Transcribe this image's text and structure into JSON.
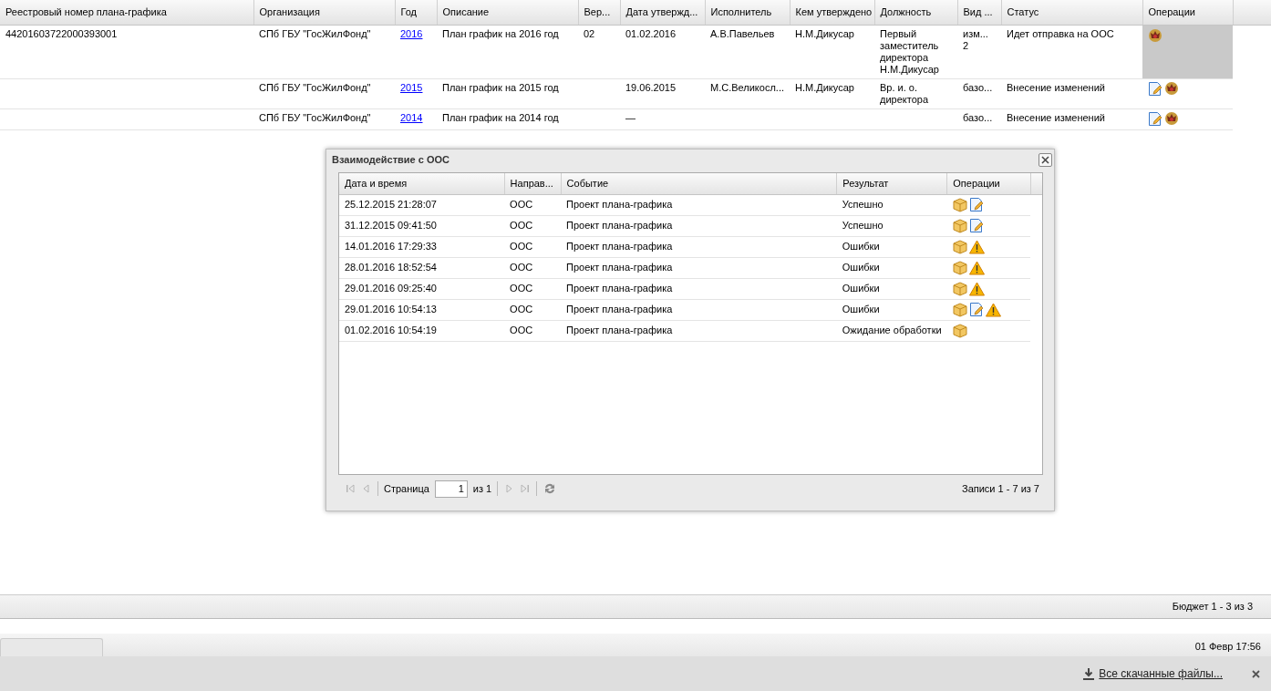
{
  "grid": {
    "columns": [
      "Реестровый номер плана-графика",
      "Организация",
      "Год",
      "Описание",
      "Вер...",
      "Дата утвержд...",
      "Исполнитель",
      "Кем утверждено",
      "Должность",
      "Вид ...",
      "Статус",
      "Операции"
    ],
    "rows": [
      {
        "selected": true,
        "cells": [
          "44201603722000393001",
          "СПб ГБУ \"ГосЖилФонд\"",
          "2016",
          "План график на 2016 год",
          "02",
          "01.02.2016",
          "А.В.Павельев",
          "Н.М.Дикусар",
          "Первый заместитель директора Н.М.Дикусар",
          "изм... 2",
          "Идет отправка на ООС"
        ],
        "operations": [
          {
            "kind": "emblem"
          }
        ]
      },
      {
        "selected": false,
        "cells": [
          "",
          "СПб ГБУ \"ГосЖилФонд\"",
          "2015",
          "План график на 2015 год",
          "",
          "19.06.2015",
          "М.С.Великосл...",
          "Н.М.Дикусар",
          "Вр. и. о. директора",
          "базо...",
          "Внесение изменений"
        ],
        "operations": [
          {
            "kind": "edit"
          },
          {
            "kind": "emblem"
          }
        ]
      },
      {
        "selected": false,
        "cells": [
          "",
          "СПб ГБУ \"ГосЖилФонд\"",
          "2014",
          "План график на 2014 год",
          "",
          "—",
          "",
          "",
          "",
          "базо...",
          "Внесение изменений"
        ],
        "operations": [
          {
            "kind": "edit"
          },
          {
            "kind": "emblem"
          }
        ]
      }
    ],
    "footer": "Бюджет 1 - 3 из 3"
  },
  "dialog": {
    "title": "Взаимодействие с ООС",
    "columns": [
      "Дата и время",
      "Направ...",
      "Событие",
      "Результат",
      "Операции"
    ],
    "rows": [
      {
        "cells": [
          "25.12.2015 21:28:07",
          "ООС",
          "Проект плана-графика",
          "Успешно"
        ],
        "operations": [
          {
            "kind": "package"
          },
          {
            "kind": "edit"
          }
        ]
      },
      {
        "cells": [
          "31.12.2015 09:41:50",
          "ООС",
          "Проект плана-графика",
          "Успешно"
        ],
        "operations": [
          {
            "kind": "package"
          },
          {
            "kind": "edit"
          }
        ]
      },
      {
        "cells": [
          "14.01.2016 17:29:33",
          "ООС",
          "Проект плана-графика",
          "Ошибки"
        ],
        "operations": [
          {
            "kind": "package"
          },
          {
            "kind": "warning"
          }
        ]
      },
      {
        "cells": [
          "28.01.2016 18:52:54",
          "ООС",
          "Проект плана-графика",
          "Ошибки"
        ],
        "operations": [
          {
            "kind": "package"
          },
          {
            "kind": "warning"
          }
        ]
      },
      {
        "cells": [
          "29.01.2016 09:25:40",
          "ООС",
          "Проект плана-графика",
          "Ошибки"
        ],
        "operations": [
          {
            "kind": "package"
          },
          {
            "kind": "warning"
          }
        ]
      },
      {
        "cells": [
          "29.01.2016 10:54:13",
          "ООС",
          "Проект плана-графика",
          "Ошибки"
        ],
        "operations": [
          {
            "kind": "package"
          },
          {
            "kind": "edit"
          },
          {
            "kind": "warning"
          }
        ]
      },
      {
        "cells": [
          "01.02.2016 10:54:19",
          "ООС",
          "Проект плана-графика",
          "Ожидание обработки"
        ],
        "operations": [
          {
            "kind": "package"
          }
        ]
      }
    ],
    "pager": {
      "page_label": "Страница",
      "page": "1",
      "of": "из 1",
      "first_disabled": true,
      "prev_disabled": true,
      "next_disabled": true,
      "last_disabled": true,
      "summary": "Записи 1 - 7 из 7"
    }
  },
  "taskbar": {
    "clock": "01 Февр 17:56"
  },
  "downloads": {
    "link": "Все скачанные файлы..."
  }
}
